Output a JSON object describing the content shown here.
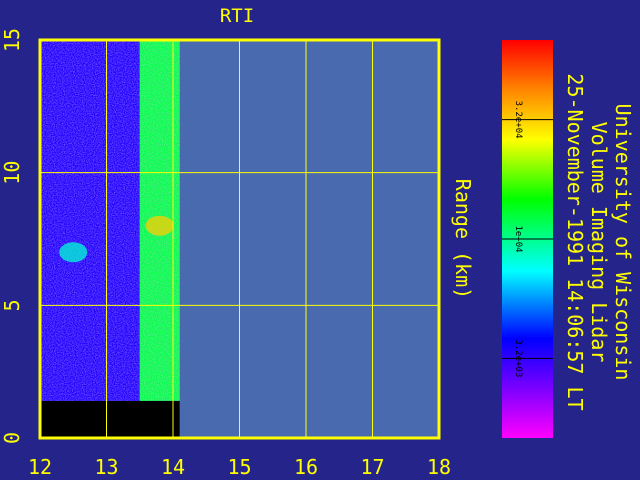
{
  "colors": {
    "background": "#24248a",
    "frame": "#ffff00",
    "grid": "#ffff00",
    "text": "#ffff00",
    "empty_region": "#4a6ab0",
    "blank_band": "#000000",
    "colorbar_text": "#000000"
  },
  "chart_data": {
    "type": "heatmap",
    "title": "RTI",
    "xlabel": "",
    "ylabel": "Range (km)",
    "x_ticks": [
      "12",
      "13",
      "14",
      "15",
      "16",
      "17",
      "18"
    ],
    "y_ticks": [
      "0",
      "5",
      "10",
      "15"
    ],
    "xlim": [
      12,
      18
    ],
    "ylim": [
      0,
      15
    ],
    "data_extent": {
      "x_start": 12,
      "x_end": 14.1,
      "y_min": 1.4,
      "y_max": 15
    },
    "segments": [
      {
        "x_start": 12.0,
        "x_end": 13.5,
        "level": 0.22
      },
      {
        "x_start": 13.5,
        "x_end": 14.1,
        "level": 0.55
      }
    ],
    "features": [
      {
        "x": 13.8,
        "y": 8.0,
        "level": 0.8
      },
      {
        "x": 12.5,
        "y": 7.0,
        "level": 0.45
      }
    ],
    "colorbar": {
      "tick_labels": [
        "3.2e+04",
        "1e+04",
        "3.2e+03"
      ],
      "tick_fracs": [
        0.8,
        0.5,
        0.2
      ]
    },
    "side_text": {
      "line1": "University of Wisconsin",
      "line2": "Volume Imaging Lidar",
      "line3": "25-November-1991 14:06:57 LT"
    }
  }
}
